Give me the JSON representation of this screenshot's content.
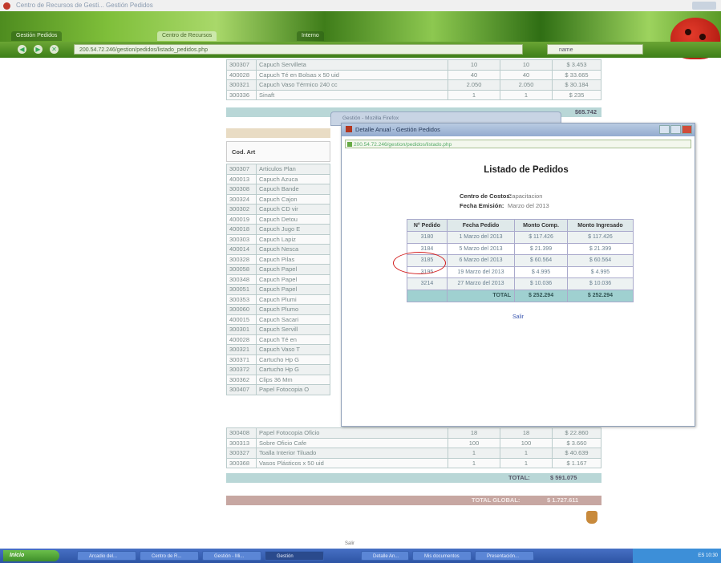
{
  "browser": {
    "window_title": "Centro de Recursos de Gesti...  Gestión Pedidos",
    "tabs": [
      "Gestión Pedidos",
      "Centro de Recursos",
      "Interno"
    ],
    "url": "200.54.72.246/gestion/pedidos/listado_pedidos.php",
    "search_text": "name"
  },
  "back_page": {
    "top_rows": [
      {
        "code": "300307",
        "desc": "Capuch Servilleta",
        "q1": "10",
        "q2": "10",
        "amt": "$ 3.453"
      },
      {
        "code": "400028",
        "desc": "Capuch Té en Bolsas x 50 uid",
        "q1": "40",
        "q2": "40",
        "amt": "$ 33.665"
      },
      {
        "code": "300321",
        "desc": "Capuch Vaso Térmico 240 cc",
        "q1": "2.050",
        "q2": "2.050",
        "amt": "$ 30.184"
      },
      {
        "code": "300336",
        "desc": "Sinaft",
        "q1": "1",
        "q2": "1",
        "amt": "$ 235"
      }
    ],
    "top_total": "$65.742",
    "code_header": "Cod. Art",
    "list_rows": [
      {
        "code": "300307",
        "desc": "Articulos Plan"
      },
      {
        "code": "400013",
        "desc": "Capuch Azuca"
      },
      {
        "code": "300308",
        "desc": "Capuch Bande"
      },
      {
        "code": "300324",
        "desc": "Capuch Cajon"
      },
      {
        "code": "300302",
        "desc": "Capuch CD vir"
      },
      {
        "code": "400019",
        "desc": "Capuch Detou"
      },
      {
        "code": "400018",
        "desc": "Capuch Jugo E"
      },
      {
        "code": "300303",
        "desc": "Capuch Lapiz"
      },
      {
        "code": "400014",
        "desc": "Capuch Nesca"
      },
      {
        "code": "300328",
        "desc": "Capuch Pilas"
      },
      {
        "code": "300058",
        "desc": "Capuch Papel"
      },
      {
        "code": "300348",
        "desc": "Capuch Papel"
      },
      {
        "code": "300051",
        "desc": "Capuch Papel"
      },
      {
        "code": "300353",
        "desc": "Capuch Plumi"
      },
      {
        "code": "300060",
        "desc": "Capuch Plumo"
      },
      {
        "code": "400015",
        "desc": "Capuch Sacari"
      },
      {
        "code": "300301",
        "desc": "Capuch Servill"
      },
      {
        "code": "400028",
        "desc": "Capuch Té en"
      },
      {
        "code": "300321",
        "desc": "Capuch Vaso T"
      },
      {
        "code": "300371",
        "desc": "Cartucho Hp G"
      },
      {
        "code": "300372",
        "desc": "Cartucho Hp G"
      },
      {
        "code": "300362",
        "desc": "Clips 36 Mm"
      },
      {
        "code": "300407",
        "desc": "Papel Fotocopia O"
      }
    ],
    "bottom_rows": [
      {
        "code": "300408",
        "desc": "Papel Fotocopia Oficio",
        "q1": "18",
        "q2": "18",
        "amt": "$ 22.860"
      },
      {
        "code": "300313",
        "desc": "Sobre Oficio Cafe",
        "q1": "100",
        "q2": "100",
        "amt": "$ 3.660"
      },
      {
        "code": "300327",
        "desc": "Toalla Interior Tiluado",
        "q1": "1",
        "q2": "1",
        "amt": "$ 40.639"
      },
      {
        "code": "300368",
        "desc": "Vasos Plásticos x 50 uid",
        "q1": "1",
        "q2": "1",
        "amt": "$ 1.167"
      }
    ],
    "total_label": "TOTAL:",
    "total_value": "$ 591.075",
    "global_label": "TOTAL GLOBAL:",
    "global_value": "$ 1.727.611"
  },
  "popup": {
    "back_title": "Gestión - Mozilla Firefox",
    "title": "Detalle Anual - Gestión Pedidos",
    "url": "200.54.72.246/gestion/pedidos/listado.php",
    "heading": "Listado de Pedidos",
    "centro_label": "Centro de Costos:",
    "centro_value": "Capacitacion",
    "fecha_label": "Fecha Emisión:",
    "fecha_value": "Marzo del 2013",
    "headers": [
      "N° Pedido",
      "Fecha Pedido",
      "Monto Comp.",
      "Monto Ingresado"
    ],
    "rows": [
      {
        "num": "3180",
        "date": "1 Marzo del 2013",
        "comp": "$ 117.426",
        "ing": "$ 117.426"
      },
      {
        "num": "3184",
        "date": "5 Marzo del 2013",
        "comp": "$ 21.399",
        "ing": "$ 21.399"
      },
      {
        "num": "3185",
        "date": "6 Marzo del 2013",
        "comp": "$ 60.564",
        "ing": "$ 60.564"
      },
      {
        "num": "3195",
        "date": "19 Marzo del 2013",
        "comp": "$ 4.995",
        "ing": "$ 4.995"
      },
      {
        "num": "3214",
        "date": "27 Marzo del 2013",
        "comp": "$ 10.036",
        "ing": "$ 10.036"
      }
    ],
    "total_label": "TOTAL",
    "total_comp": "$ 252.294",
    "total_ing": "$ 252.294",
    "exit_link": "Salir"
  },
  "taskbar": {
    "start": "Inicio",
    "hint": "Salir",
    "tasks": [
      "Arcadio del...",
      "Centro de R...",
      "Gestión - Mi...",
      "Gestión",
      "Detalle An...",
      "Mis documentos",
      "Presentación..."
    ],
    "tray": "ES 10:30"
  },
  "colors": {
    "accent_green": "#6aa534",
    "table_total": "#9fd0d0",
    "global_total": "#c7a7a2",
    "circle": "#d21c1c"
  }
}
